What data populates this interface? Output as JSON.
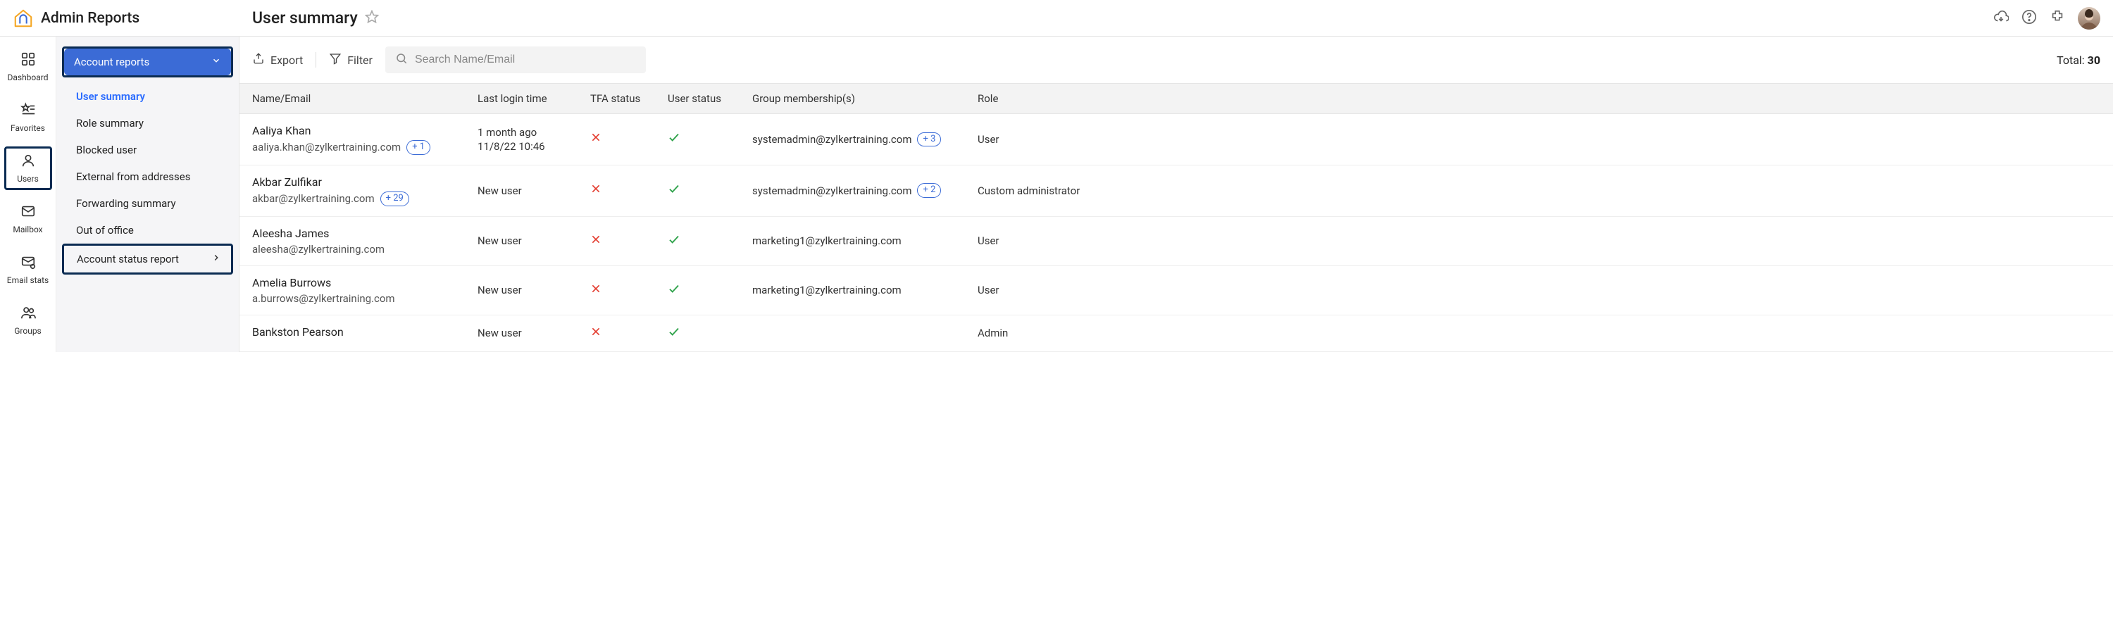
{
  "header": {
    "app_name": "Admin Reports",
    "page_title": "User summary"
  },
  "rail": {
    "items": [
      {
        "label": "Dashboard",
        "icon": "grid"
      },
      {
        "label": "Favorites",
        "icon": "star-list"
      },
      {
        "label": "Users",
        "icon": "user",
        "active": true
      },
      {
        "label": "Mailbox",
        "icon": "mail"
      },
      {
        "label": "Email stats",
        "icon": "mail-gear"
      },
      {
        "label": "Groups",
        "icon": "users"
      }
    ]
  },
  "sidebar": {
    "dropdown_label": "Account reports",
    "items": [
      {
        "label": "User summary",
        "selected": true
      },
      {
        "label": "Role summary"
      },
      {
        "label": "Blocked user"
      },
      {
        "label": "External from addresses"
      },
      {
        "label": "Forwarding summary"
      },
      {
        "label": "Out of office"
      }
    ],
    "status_report_label": "Account status report"
  },
  "toolbar": {
    "export_label": "Export",
    "filter_label": "Filter",
    "search_placeholder": "Search Name/Email",
    "total_label": "Total:",
    "total_value": "30"
  },
  "columns": [
    "Name/Email",
    "Last login time",
    "TFA status",
    "User status",
    "Group membership(s)",
    "Role"
  ],
  "rows": [
    {
      "name": "Aaliya Khan",
      "email": "aaliya.khan@zylkertraining.com",
      "email_badge": "+ 1",
      "login_rel": "1 month ago",
      "login_abs": "11/8/22 10:46",
      "tfa": false,
      "user_ok": true,
      "group": "systemadmin@zylkertraining.com",
      "group_badge": "+ 3",
      "role": "User"
    },
    {
      "name": "Akbar Zulfikar",
      "email": "akbar@zylkertraining.com",
      "email_badge": "+ 29",
      "login_rel": "New user",
      "login_abs": null,
      "tfa": false,
      "user_ok": true,
      "group": "systemadmin@zylkertraining.com",
      "group_badge": "+ 2",
      "role": "Custom administrator"
    },
    {
      "name": "Aleesha James",
      "email": "aleesha@zylkertraining.com",
      "email_badge": null,
      "login_rel": "New user",
      "login_abs": null,
      "tfa": false,
      "user_ok": true,
      "group": "marketing1@zylkertraining.com",
      "group_badge": null,
      "role": "User"
    },
    {
      "name": "Amelia Burrows",
      "email": "a.burrows@zylkertraining.com",
      "email_badge": null,
      "login_rel": "New user",
      "login_abs": null,
      "tfa": false,
      "user_ok": true,
      "group": "marketing1@zylkertraining.com",
      "group_badge": null,
      "role": "User"
    },
    {
      "name": "Bankston Pearson",
      "email": "",
      "email_badge": null,
      "login_rel": "New user",
      "login_abs": null,
      "tfa": false,
      "user_ok": true,
      "group": "",
      "group_badge": null,
      "role": "Admin"
    }
  ]
}
